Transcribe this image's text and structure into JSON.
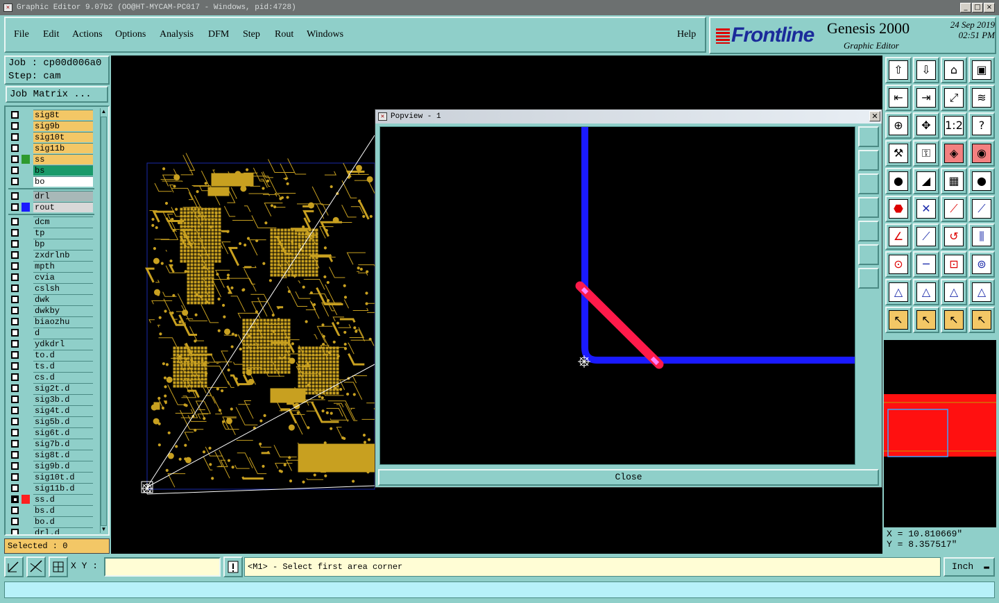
{
  "window": {
    "title": "Graphic Editor 9.07b2 (OO@HT-MYCAM-PC017 - Windows, pid:4728)",
    "minimize": "_",
    "maximize": "□",
    "close": "×"
  },
  "menu": {
    "items": [
      "File",
      "Edit",
      "Actions",
      "Options",
      "Analysis",
      "DFM",
      "Step",
      "Rout",
      "Windows"
    ],
    "help": "Help"
  },
  "brand": {
    "logo": "Frontline",
    "product": "Genesis 2000",
    "subtitle": "Graphic Editor",
    "date": "24 Sep 2019",
    "time": "02:51 PM"
  },
  "job": {
    "job_label": "Job : cp00d006a0",
    "step_label": "Step: cam",
    "matrix_button": "Job Matrix ..."
  },
  "layers": [
    {
      "name": "sig8t",
      "bg": "#f3c766",
      "color": ""
    },
    {
      "name": "sig9b",
      "bg": "#f3c766",
      "color": ""
    },
    {
      "name": "sig10t",
      "bg": "#f3c766",
      "color": ""
    },
    {
      "name": "sig11b",
      "bg": "#f3c766",
      "color": ""
    },
    {
      "name": "ss",
      "bg": "#f3c766",
      "color": "#2e9a2e"
    },
    {
      "name": "bs",
      "bg": "#1a9a6a",
      "color": ""
    },
    {
      "name": "bo",
      "bg": "#ffffff",
      "color": ""
    },
    {
      "name": "drl",
      "bg": "#a8b8b8",
      "color": "",
      "sep": true
    },
    {
      "name": "rout",
      "bg": "#d8d8d8",
      "color": "#1a1aff"
    },
    {
      "name": "dcm",
      "bg": "#8fcfc9",
      "color": "",
      "sep": true
    },
    {
      "name": "tp",
      "bg": "#8fcfc9",
      "color": ""
    },
    {
      "name": "bp",
      "bg": "#8fcfc9",
      "color": ""
    },
    {
      "name": "zxdrlnb",
      "bg": "#8fcfc9",
      "color": ""
    },
    {
      "name": "mpth",
      "bg": "#8fcfc9",
      "color": ""
    },
    {
      "name": "cvia",
      "bg": "#8fcfc9",
      "color": ""
    },
    {
      "name": "cslsh",
      "bg": "#8fcfc9",
      "color": ""
    },
    {
      "name": "dwk",
      "bg": "#8fcfc9",
      "color": ""
    },
    {
      "name": "dwkby",
      "bg": "#8fcfc9",
      "color": ""
    },
    {
      "name": "biaozhu",
      "bg": "#8fcfc9",
      "color": ""
    },
    {
      "name": "d",
      "bg": "#8fcfc9",
      "color": ""
    },
    {
      "name": "ydkdrl",
      "bg": "#8fcfc9",
      "color": ""
    },
    {
      "name": "to.d",
      "bg": "#8fcfc9",
      "color": ""
    },
    {
      "name": "ts.d",
      "bg": "#8fcfc9",
      "color": ""
    },
    {
      "name": "cs.d",
      "bg": "#8fcfc9",
      "color": ""
    },
    {
      "name": "sig2t.d",
      "bg": "#8fcfc9",
      "color": ""
    },
    {
      "name": "sig3b.d",
      "bg": "#8fcfc9",
      "color": ""
    },
    {
      "name": "sig4t.d",
      "bg": "#8fcfc9",
      "color": ""
    },
    {
      "name": "sig5b.d",
      "bg": "#8fcfc9",
      "color": ""
    },
    {
      "name": "sig6t.d",
      "bg": "#8fcfc9",
      "color": ""
    },
    {
      "name": "sig7b.d",
      "bg": "#8fcfc9",
      "color": ""
    },
    {
      "name": "sig8t.d",
      "bg": "#8fcfc9",
      "color": ""
    },
    {
      "name": "sig9b.d",
      "bg": "#8fcfc9",
      "color": ""
    },
    {
      "name": "sig10t.d",
      "bg": "#8fcfc9",
      "color": ""
    },
    {
      "name": "sig11b.d",
      "bg": "#8fcfc9",
      "color": ""
    },
    {
      "name": "ss.d",
      "bg": "#8fcfc9",
      "color": "#ff2020",
      "active": true
    },
    {
      "name": "bs.d",
      "bg": "#8fcfc9",
      "color": ""
    },
    {
      "name": "bo.d",
      "bg": "#8fcfc9",
      "color": ""
    },
    {
      "name": "drl.d",
      "bg": "#8fcfc9",
      "color": ""
    }
  ],
  "selected": "Selected : 0",
  "popview": {
    "title": "Popview - 1",
    "close_button": "Close"
  },
  "coords": {
    "x": "X = 10.810669\"",
    "y": "Y = 8.357517\""
  },
  "bottom": {
    "xy_label": "X Y :",
    "xy_value": "",
    "prompt": "<M1> - Select first area corner",
    "units": "Inch"
  },
  "colors": {
    "board": "#c8a020",
    "track_blue": "#1a1aff",
    "track_red": "#ff1a4a"
  }
}
